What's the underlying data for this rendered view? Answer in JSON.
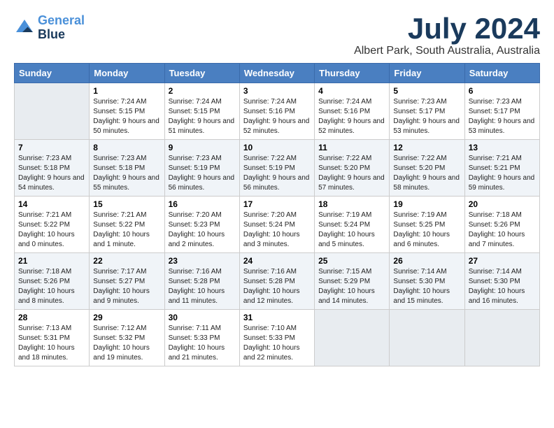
{
  "logo": {
    "line1": "General",
    "line2": "Blue"
  },
  "title": "July 2024",
  "location": "Albert Park, South Australia, Australia",
  "weekdays": [
    "Sunday",
    "Monday",
    "Tuesday",
    "Wednesday",
    "Thursday",
    "Friday",
    "Saturday"
  ],
  "weeks": [
    [
      {
        "num": "",
        "sunrise": "",
        "sunset": "",
        "daylight": ""
      },
      {
        "num": "1",
        "sunrise": "Sunrise: 7:24 AM",
        "sunset": "Sunset: 5:15 PM",
        "daylight": "Daylight: 9 hours and 50 minutes."
      },
      {
        "num": "2",
        "sunrise": "Sunrise: 7:24 AM",
        "sunset": "Sunset: 5:15 PM",
        "daylight": "Daylight: 9 hours and 51 minutes."
      },
      {
        "num": "3",
        "sunrise": "Sunrise: 7:24 AM",
        "sunset": "Sunset: 5:16 PM",
        "daylight": "Daylight: 9 hours and 52 minutes."
      },
      {
        "num": "4",
        "sunrise": "Sunrise: 7:24 AM",
        "sunset": "Sunset: 5:16 PM",
        "daylight": "Daylight: 9 hours and 52 minutes."
      },
      {
        "num": "5",
        "sunrise": "Sunrise: 7:23 AM",
        "sunset": "Sunset: 5:17 PM",
        "daylight": "Daylight: 9 hours and 53 minutes."
      },
      {
        "num": "6",
        "sunrise": "Sunrise: 7:23 AM",
        "sunset": "Sunset: 5:17 PM",
        "daylight": "Daylight: 9 hours and 53 minutes."
      }
    ],
    [
      {
        "num": "7",
        "sunrise": "Sunrise: 7:23 AM",
        "sunset": "Sunset: 5:18 PM",
        "daylight": "Daylight: 9 hours and 54 minutes."
      },
      {
        "num": "8",
        "sunrise": "Sunrise: 7:23 AM",
        "sunset": "Sunset: 5:18 PM",
        "daylight": "Daylight: 9 hours and 55 minutes."
      },
      {
        "num": "9",
        "sunrise": "Sunrise: 7:23 AM",
        "sunset": "Sunset: 5:19 PM",
        "daylight": "Daylight: 9 hours and 56 minutes."
      },
      {
        "num": "10",
        "sunrise": "Sunrise: 7:22 AM",
        "sunset": "Sunset: 5:19 PM",
        "daylight": "Daylight: 9 hours and 56 minutes."
      },
      {
        "num": "11",
        "sunrise": "Sunrise: 7:22 AM",
        "sunset": "Sunset: 5:20 PM",
        "daylight": "Daylight: 9 hours and 57 minutes."
      },
      {
        "num": "12",
        "sunrise": "Sunrise: 7:22 AM",
        "sunset": "Sunset: 5:20 PM",
        "daylight": "Daylight: 9 hours and 58 minutes."
      },
      {
        "num": "13",
        "sunrise": "Sunrise: 7:21 AM",
        "sunset": "Sunset: 5:21 PM",
        "daylight": "Daylight: 9 hours and 59 minutes."
      }
    ],
    [
      {
        "num": "14",
        "sunrise": "Sunrise: 7:21 AM",
        "sunset": "Sunset: 5:22 PM",
        "daylight": "Daylight: 10 hours and 0 minutes."
      },
      {
        "num": "15",
        "sunrise": "Sunrise: 7:21 AM",
        "sunset": "Sunset: 5:22 PM",
        "daylight": "Daylight: 10 hours and 1 minute."
      },
      {
        "num": "16",
        "sunrise": "Sunrise: 7:20 AM",
        "sunset": "Sunset: 5:23 PM",
        "daylight": "Daylight: 10 hours and 2 minutes."
      },
      {
        "num": "17",
        "sunrise": "Sunrise: 7:20 AM",
        "sunset": "Sunset: 5:24 PM",
        "daylight": "Daylight: 10 hours and 3 minutes."
      },
      {
        "num": "18",
        "sunrise": "Sunrise: 7:19 AM",
        "sunset": "Sunset: 5:24 PM",
        "daylight": "Daylight: 10 hours and 5 minutes."
      },
      {
        "num": "19",
        "sunrise": "Sunrise: 7:19 AM",
        "sunset": "Sunset: 5:25 PM",
        "daylight": "Daylight: 10 hours and 6 minutes."
      },
      {
        "num": "20",
        "sunrise": "Sunrise: 7:18 AM",
        "sunset": "Sunset: 5:26 PM",
        "daylight": "Daylight: 10 hours and 7 minutes."
      }
    ],
    [
      {
        "num": "21",
        "sunrise": "Sunrise: 7:18 AM",
        "sunset": "Sunset: 5:26 PM",
        "daylight": "Daylight: 10 hours and 8 minutes."
      },
      {
        "num": "22",
        "sunrise": "Sunrise: 7:17 AM",
        "sunset": "Sunset: 5:27 PM",
        "daylight": "Daylight: 10 hours and 9 minutes."
      },
      {
        "num": "23",
        "sunrise": "Sunrise: 7:16 AM",
        "sunset": "Sunset: 5:28 PM",
        "daylight": "Daylight: 10 hours and 11 minutes."
      },
      {
        "num": "24",
        "sunrise": "Sunrise: 7:16 AM",
        "sunset": "Sunset: 5:28 PM",
        "daylight": "Daylight: 10 hours and 12 minutes."
      },
      {
        "num": "25",
        "sunrise": "Sunrise: 7:15 AM",
        "sunset": "Sunset: 5:29 PM",
        "daylight": "Daylight: 10 hours and 14 minutes."
      },
      {
        "num": "26",
        "sunrise": "Sunrise: 7:14 AM",
        "sunset": "Sunset: 5:30 PM",
        "daylight": "Daylight: 10 hours and 15 minutes."
      },
      {
        "num": "27",
        "sunrise": "Sunrise: 7:14 AM",
        "sunset": "Sunset: 5:30 PM",
        "daylight": "Daylight: 10 hours and 16 minutes."
      }
    ],
    [
      {
        "num": "28",
        "sunrise": "Sunrise: 7:13 AM",
        "sunset": "Sunset: 5:31 PM",
        "daylight": "Daylight: 10 hours and 18 minutes."
      },
      {
        "num": "29",
        "sunrise": "Sunrise: 7:12 AM",
        "sunset": "Sunset: 5:32 PM",
        "daylight": "Daylight: 10 hours and 19 minutes."
      },
      {
        "num": "30",
        "sunrise": "Sunrise: 7:11 AM",
        "sunset": "Sunset: 5:33 PM",
        "daylight": "Daylight: 10 hours and 21 minutes."
      },
      {
        "num": "31",
        "sunrise": "Sunrise: 7:10 AM",
        "sunset": "Sunset: 5:33 PM",
        "daylight": "Daylight: 10 hours and 22 minutes."
      },
      {
        "num": "",
        "sunrise": "",
        "sunset": "",
        "daylight": ""
      },
      {
        "num": "",
        "sunrise": "",
        "sunset": "",
        "daylight": ""
      },
      {
        "num": "",
        "sunrise": "",
        "sunset": "",
        "daylight": ""
      }
    ]
  ]
}
